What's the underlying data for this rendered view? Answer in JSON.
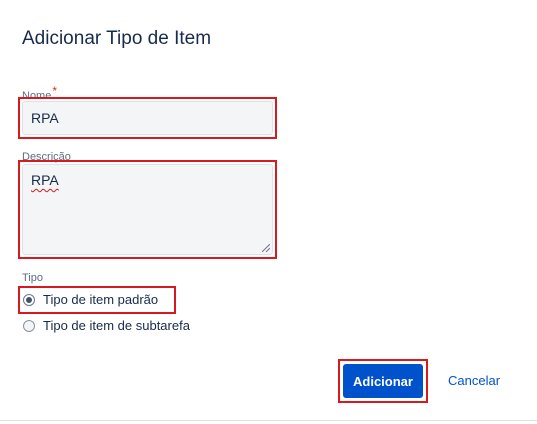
{
  "dialog": {
    "title": "Adicionar Tipo de Item"
  },
  "form": {
    "name": {
      "label": "Nome",
      "required_marker": "*",
      "value": "RPA"
    },
    "description": {
      "label": "Descrição",
      "value": "RPA"
    },
    "type": {
      "label": "Tipo",
      "options": [
        {
          "label": "Tipo de item padrão",
          "selected": true
        },
        {
          "label": "Tipo de item de subtarefa",
          "selected": false
        }
      ]
    }
  },
  "actions": {
    "submit_label": "Adicionar",
    "cancel_label": "Cancelar"
  },
  "colors": {
    "primary": "#0052cc",
    "highlight": "#d71920",
    "required": "#de350b"
  }
}
